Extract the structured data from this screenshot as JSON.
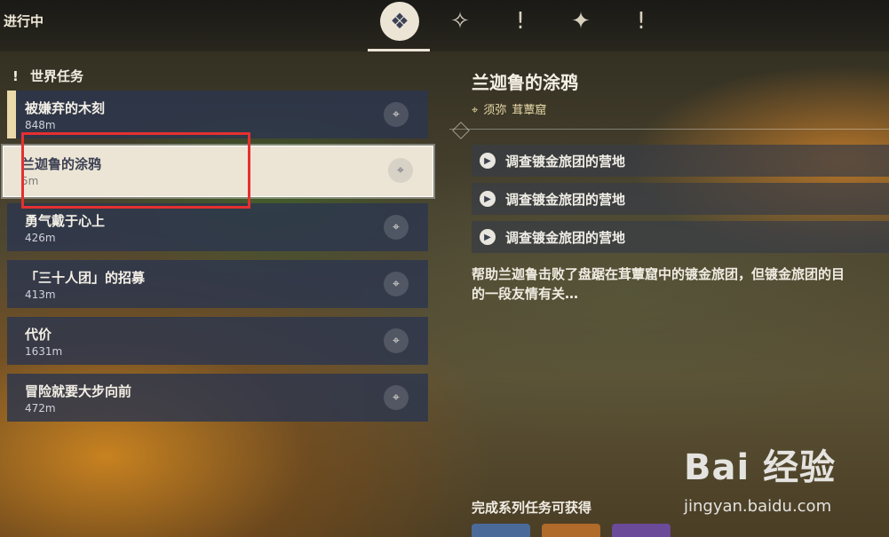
{
  "header": {
    "title": "进行中",
    "tabs": [
      {
        "icon": "diamond-cluster-icon",
        "glyph": "❖",
        "active": true
      },
      {
        "icon": "compass-emblem-icon",
        "glyph": "✧",
        "active": false
      },
      {
        "icon": "exclamation-icon",
        "glyph": "!",
        "active": false
      },
      {
        "icon": "star-emblem-icon",
        "glyph": "✦",
        "active": false
      },
      {
        "icon": "exclamation-icon",
        "glyph": "!",
        "active": false
      }
    ]
  },
  "section": {
    "bang": "!",
    "title": "世界任务"
  },
  "quests": [
    {
      "name": "被嫌弃的木刻",
      "distance": "848m"
    },
    {
      "name": "兰迦鲁的涂鸦",
      "distance": "5m",
      "selected": true
    },
    {
      "name": "勇气戴于心上",
      "distance": "426m"
    },
    {
      "name": "「三十人团」的招募",
      "distance": "413m"
    },
    {
      "name": "代价",
      "distance": "1631m"
    },
    {
      "name": "冒险就要大步向前",
      "distance": "472m"
    }
  ],
  "detail": {
    "title": "兰迦鲁的涂鸦",
    "location_region": "须弥",
    "location_place": "茸蕈窟",
    "steps": [
      "调查镀金旅团的营地",
      "调查镀金旅团的营地",
      "调查镀金旅团的营地"
    ],
    "description_line1": "帮助兰迦鲁击败了盘踞在茸蕈窟中的镀金旅团，但镀金旅团的目",
    "description_line2": "的一段友情有关…",
    "reward_heading": "完成系列任务可获得"
  },
  "watermark": {
    "logo": "Bai 经验",
    "sub": "jingyan.baidu.com"
  },
  "colors": {
    "accent": "#ece5d6",
    "highlight": "#e53030",
    "row_bg": "#2c364e"
  }
}
